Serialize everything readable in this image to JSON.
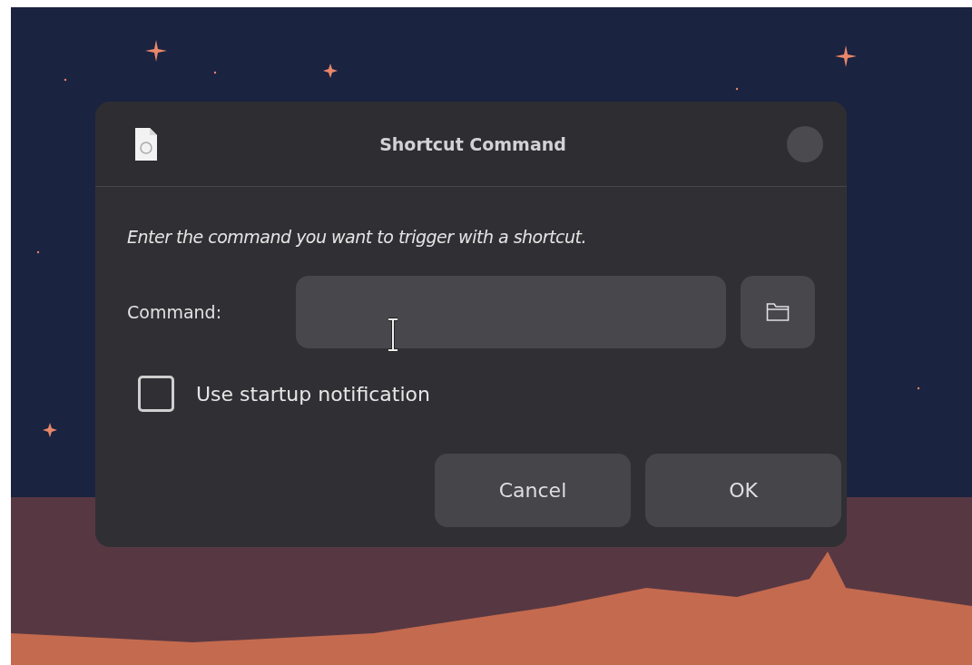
{
  "window": {
    "title": "Shortcut Command"
  },
  "description": "Enter the command you want to trigger with a shortcut.",
  "command": {
    "label": "Command:"
  },
  "startup_notification": {
    "label": "Use startup notification",
    "checked": false
  },
  "buttons": [
    {
      "label": "Cancel"
    },
    {
      "label": "OK"
    }
  ]
}
